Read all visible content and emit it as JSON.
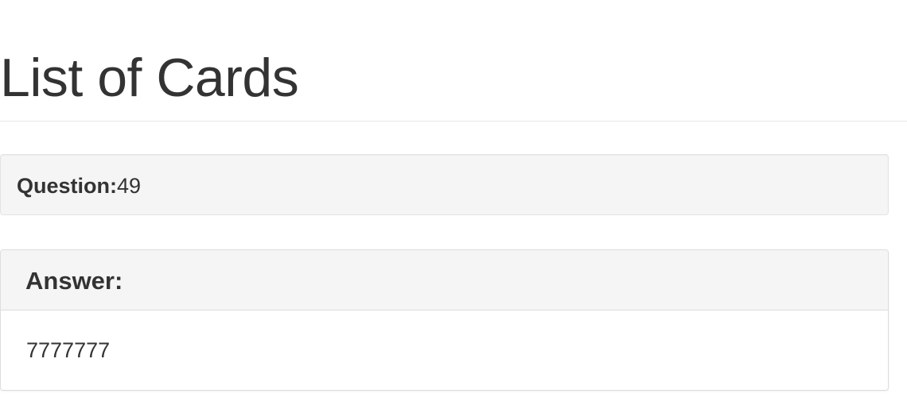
{
  "header": {
    "title": "List of Cards"
  },
  "card": {
    "question_label": "Question:",
    "question_value": "49",
    "answer_label": "Answer:",
    "answer_value": "7777777"
  }
}
